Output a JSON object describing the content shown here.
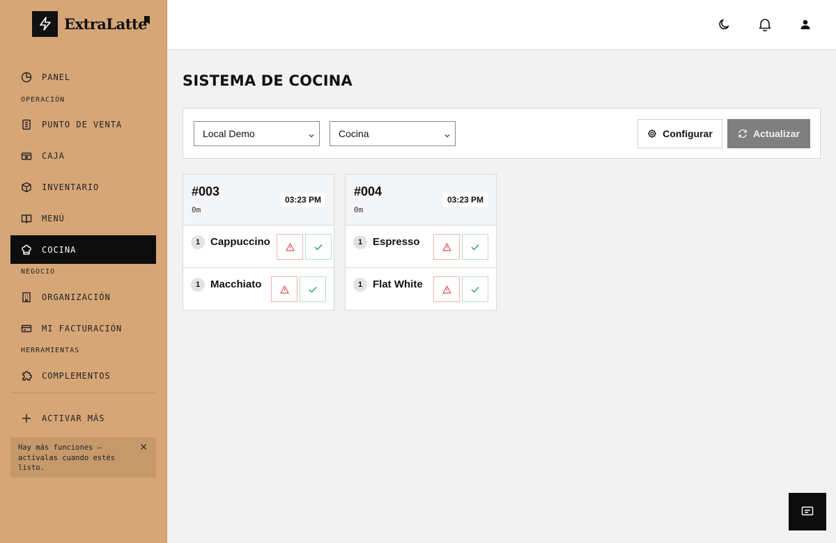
{
  "brand": {
    "name": "ExtraLatte"
  },
  "nav": {
    "panel": "PANEL",
    "section_operation": "OPERACIÓN",
    "pos": "PUNTO DE VENTA",
    "cash": "CAJA",
    "inventory": "INVENTARIO",
    "menu": "MENÚ",
    "kitchen": "COCINA",
    "section_business": "NEGOCIO",
    "organization": "ORGANIZACIÓN",
    "billing": "MI FACTURACIÓN",
    "section_tools": "HERRAMIENTAS",
    "addons": "COMPLEMENTOS",
    "activate_more": "ACTIVAR MÁS"
  },
  "tip": {
    "text": "Hay más funciones — actívalas cuando estés listo."
  },
  "page": {
    "title": "SISTEMA DE COCINA"
  },
  "toolbar": {
    "location_select": "Local Demo",
    "station_select": "Cocina",
    "configure_label": "Configurar",
    "refresh_label": "Actualizar"
  },
  "orders": [
    {
      "number": "#003",
      "age": "0m",
      "time": "03:23 PM",
      "items": [
        {
          "qty": "1",
          "name": "Cappuccino"
        },
        {
          "qty": "1",
          "name": "Macchiato"
        }
      ]
    },
    {
      "number": "#004",
      "age": "0m",
      "time": "03:23 PM",
      "items": [
        {
          "qty": "1",
          "name": "Espresso"
        },
        {
          "qty": "1",
          "name": "Flat White"
        }
      ]
    }
  ],
  "icons": {
    "brand": "lightning-icon",
    "bookmark": "bookmark-icon",
    "theme": "moon-icon",
    "notifications": "bell-icon",
    "profile": "user-icon",
    "configure": "gear-icon",
    "refresh": "refresh-icon",
    "issue": "warning-icon",
    "done": "check-icon",
    "chat": "message-icon"
  },
  "colors": {
    "sidebar": "#d6a677",
    "active_nav": "#0d0d0d",
    "refresh_button": "#7f7f7f",
    "warning": "#d9534f",
    "success": "#2e9e5b"
  }
}
